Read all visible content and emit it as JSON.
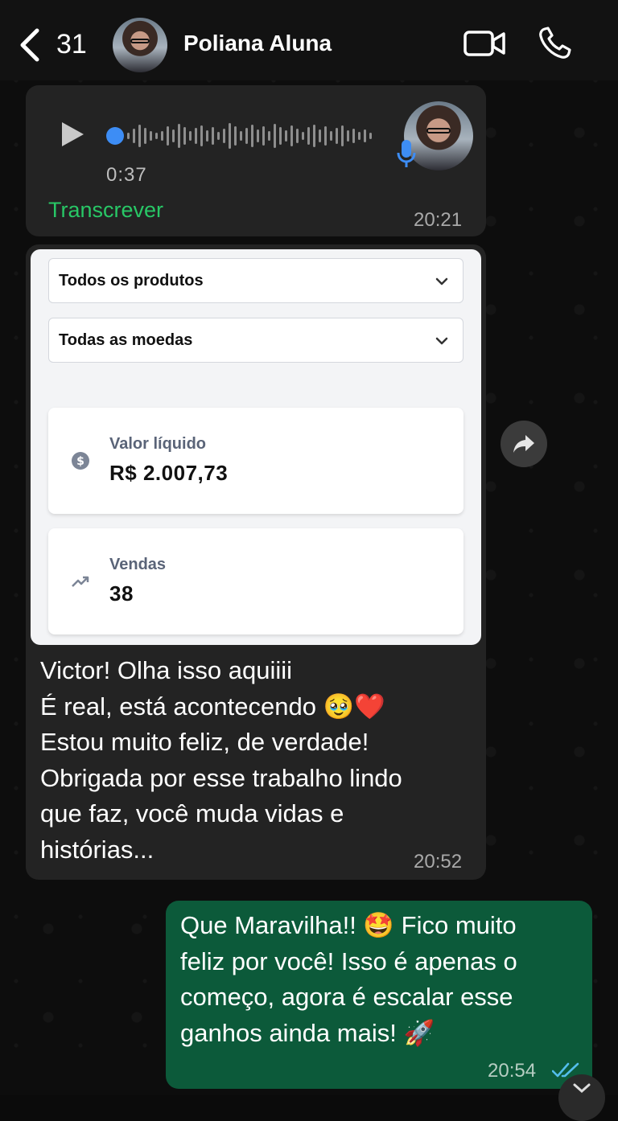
{
  "header": {
    "back_count": "31",
    "contact_name": "Poliana Aluna",
    "icons": [
      "chevron-left-icon",
      "video-call-icon",
      "phone-icon"
    ]
  },
  "voice_message": {
    "duration": "0:37",
    "transcribe_label": "Transcrever",
    "time": "20:21"
  },
  "shared_image": {
    "filters": [
      "Todos os produtos",
      "Todas as moedas"
    ],
    "net_value": {
      "label": "Valor líquido",
      "value": "R$ 2.007,73"
    },
    "sales": {
      "label": "Vendas",
      "value": "38"
    }
  },
  "incoming_message": {
    "text": "Victor! Olha isso aquiiii\nÉ real, está acontecendo 🥹❤️\nEstou muito feliz, de verdade!\nObrigada por esse trabalho lindo\nque faz, você muda vidas e\nhistórias...",
    "time": "20:52"
  },
  "outgoing_message": {
    "text": "Que Maravilha!! 🤩 Fico muito\nfeliz por você! Isso é apenas o\ncomeço, agora é escalar esse\nganhos ainda mais! 🚀",
    "time": "20:54",
    "status": "read"
  },
  "colors": {
    "incoming_bubble": "#232323",
    "outgoing_bubble": "#0c5a3a",
    "accent_green": "#28c766",
    "read_ticks": "#53bdeb"
  }
}
